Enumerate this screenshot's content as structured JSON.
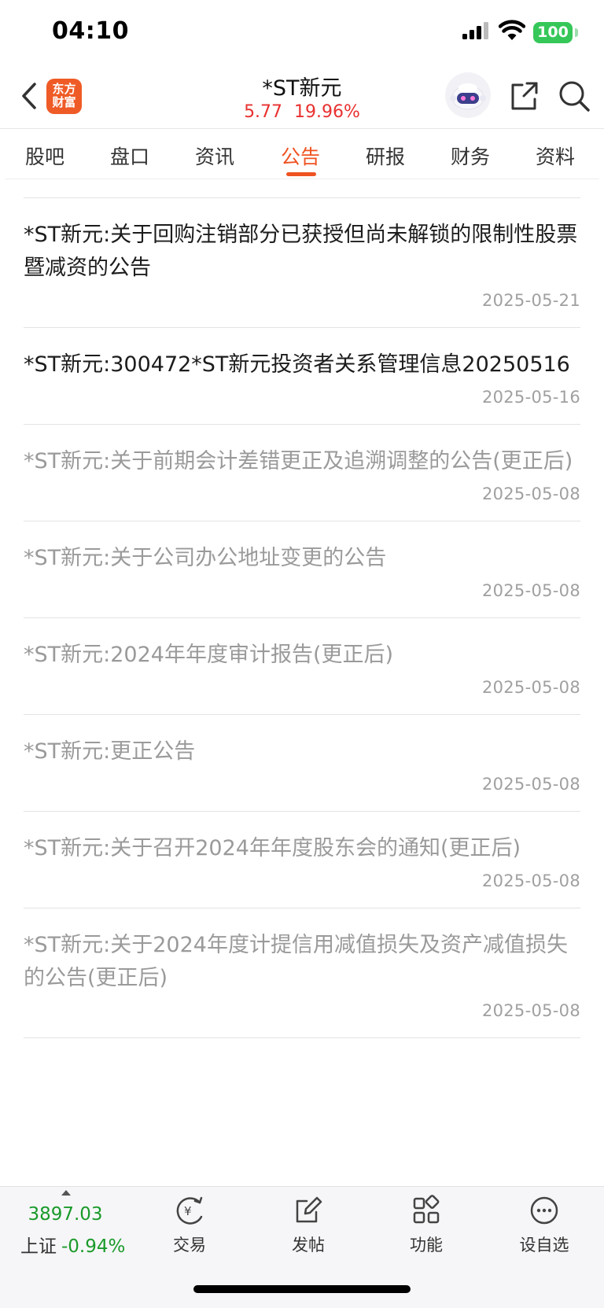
{
  "status": {
    "time": "04:10",
    "battery": "100"
  },
  "header": {
    "logo_line1": "东方",
    "logo_line2": "财富",
    "stock_name": "*ST新元",
    "price": "5.77",
    "change_pct": "19.96%"
  },
  "tabs": [
    {
      "label": "股吧"
    },
    {
      "label": "盘口"
    },
    {
      "label": "资讯"
    },
    {
      "label": "公告",
      "active": true
    },
    {
      "label": "研报"
    },
    {
      "label": "财务"
    },
    {
      "label": "资料"
    }
  ],
  "announcements": [
    {
      "title": "*ST新元:关于回购注销部分已获授但尚未解锁的限制性股票暨减资的公告",
      "date": "2025-05-21",
      "read": false
    },
    {
      "title": "*ST新元:300472*ST新元投资者关系管理信息20250516",
      "date": "2025-05-16",
      "read": false
    },
    {
      "title": "*ST新元:关于前期会计差错更正及追溯调整的公告(更正后)",
      "date": "2025-05-08",
      "read": true
    },
    {
      "title": "*ST新元:关于公司办公地址变更的公告",
      "date": "2025-05-08",
      "read": true
    },
    {
      "title": "*ST新元:2024年年度审计报告(更正后)",
      "date": "2025-05-08",
      "read": true
    },
    {
      "title": "*ST新元:更正公告",
      "date": "2025-05-08",
      "read": true
    },
    {
      "title": "*ST新元:关于召开2024年年度股东会的通知(更正后)",
      "date": "2025-05-08",
      "read": true
    },
    {
      "title": "*ST新元:关于2024年度计提信用减值损失及资产减值损失的公告(更正后)",
      "date": "2025-05-08",
      "read": true
    }
  ],
  "bottom_bar": {
    "index_value": "3897.03",
    "index_name": "上证",
    "index_change": "-0.94%",
    "trade_label": "交易",
    "post_label": "发帖",
    "functions_label": "功能",
    "watchlist_label": "设自选"
  },
  "colors": {
    "accent": "#ef5322",
    "up": "#e93030",
    "down": "#1a9a2a",
    "read_text": "#9a9a9a"
  }
}
